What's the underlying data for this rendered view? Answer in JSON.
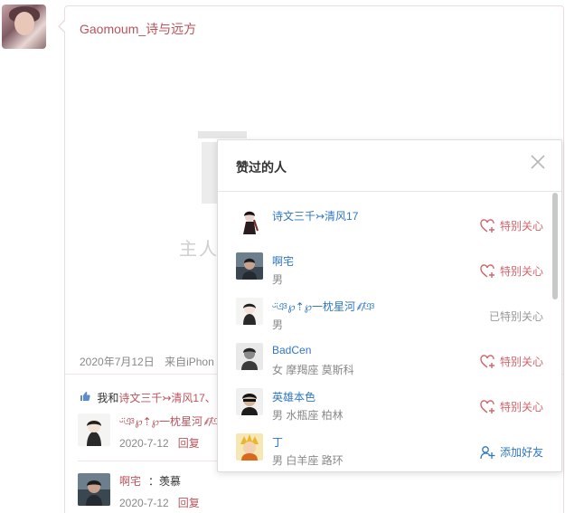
{
  "post": {
    "author": "Gaomoum_诗与远方",
    "deleted_text": "主人",
    "date": "2020年7月12日",
    "source": "来自iPhon"
  },
  "likes": {
    "prefix": "我和",
    "names": "诗文三千↣清风17、"
  },
  "comments": [
    {
      "name": "ᵕ̈ঞ℘⇡℘一枕星河⸙̸͞ঞ",
      "text": "",
      "time": "2020-7-12",
      "reply": "回复"
    },
    {
      "name": "啊宅",
      "text": "：羡慕",
      "time": "2020-7-12",
      "reply": "回复"
    }
  ],
  "popup": {
    "title": "赞过的人",
    "users": [
      {
        "name": "诗文三千↣清风17",
        "info": "",
        "action": "特别关心",
        "action_type": "follow"
      },
      {
        "name": "啊宅",
        "info": "男",
        "action": "特别关心",
        "action_type": "follow"
      },
      {
        "name": "ᵕ̈ঞ℘⇡℘一枕星河⸙̸͞ঞ",
        "info": "男",
        "action": "已特别关心",
        "action_type": "followed"
      },
      {
        "name": "BadCen",
        "info": "女  摩羯座  莫斯科",
        "action": "特别关心",
        "action_type": "follow"
      },
      {
        "name": "英雄本色",
        "info": "男  水瓶座  柏林",
        "action": "特别关心",
        "action_type": "follow"
      },
      {
        "name": "丁",
        "info": "男  白羊座  路环",
        "action": "添加好友",
        "action_type": "add"
      }
    ]
  },
  "colors": {
    "accent": "#b9535c",
    "link_blue": "#2f77c4",
    "follow_red": "#d2646c"
  },
  "icons": [
    "close-icon",
    "heart-plus-icon",
    "add-friend-icon",
    "thumbs-up-icon",
    "deleted-content-icon"
  ]
}
